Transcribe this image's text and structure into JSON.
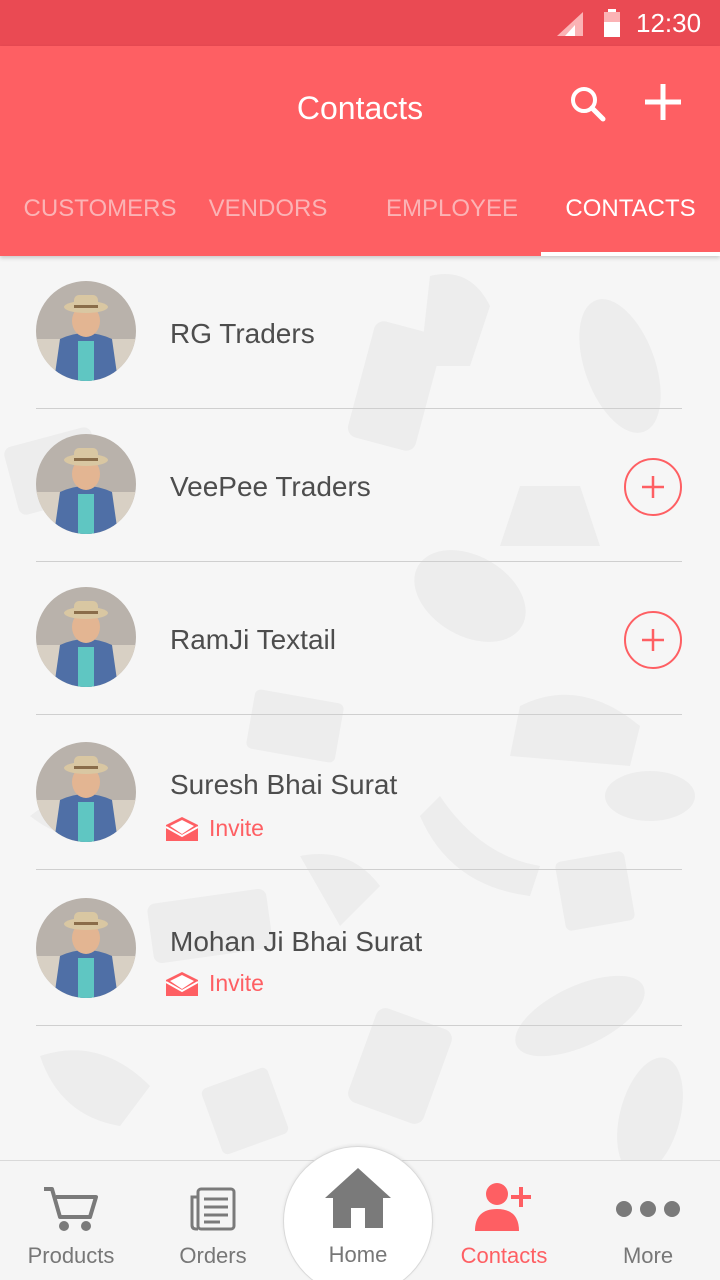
{
  "status_bar": {
    "time": "12:30"
  },
  "header": {
    "title": "Contacts"
  },
  "tabs": [
    {
      "label": "CUSTOMERS",
      "active": false
    },
    {
      "label": "VENDORS",
      "active": false
    },
    {
      "label": "EMPLOYEE",
      "active": false
    },
    {
      "label": "CONTACTS",
      "active": true
    }
  ],
  "contacts": [
    {
      "name": "RG Traders",
      "action": "none"
    },
    {
      "name": "VeePee Traders",
      "action": "add"
    },
    {
      "name": "RamJi Textail",
      "action": "add"
    },
    {
      "name": "Suresh Bhai Surat",
      "action": "invite",
      "invite_label": "Invite"
    },
    {
      "name": "Mohan Ji Bhai Surat",
      "action": "invite",
      "invite_label": "Invite"
    }
  ],
  "bottom_nav": [
    {
      "label": "Products",
      "icon": "cart-icon",
      "active": false
    },
    {
      "label": "Orders",
      "icon": "orders-icon",
      "active": false
    },
    {
      "label": "Home",
      "icon": "home-icon",
      "active": false
    },
    {
      "label": "Contacts",
      "icon": "add-person-icon",
      "active": true
    },
    {
      "label": "More",
      "icon": "more-dots-icon",
      "active": false
    }
  ],
  "colors": {
    "status_bar": "#ea4a53",
    "primary": "#fe5f63",
    "tab_inactive": "#fbb3b5",
    "text": "#4d4d4d",
    "nav_text": "#777777"
  }
}
